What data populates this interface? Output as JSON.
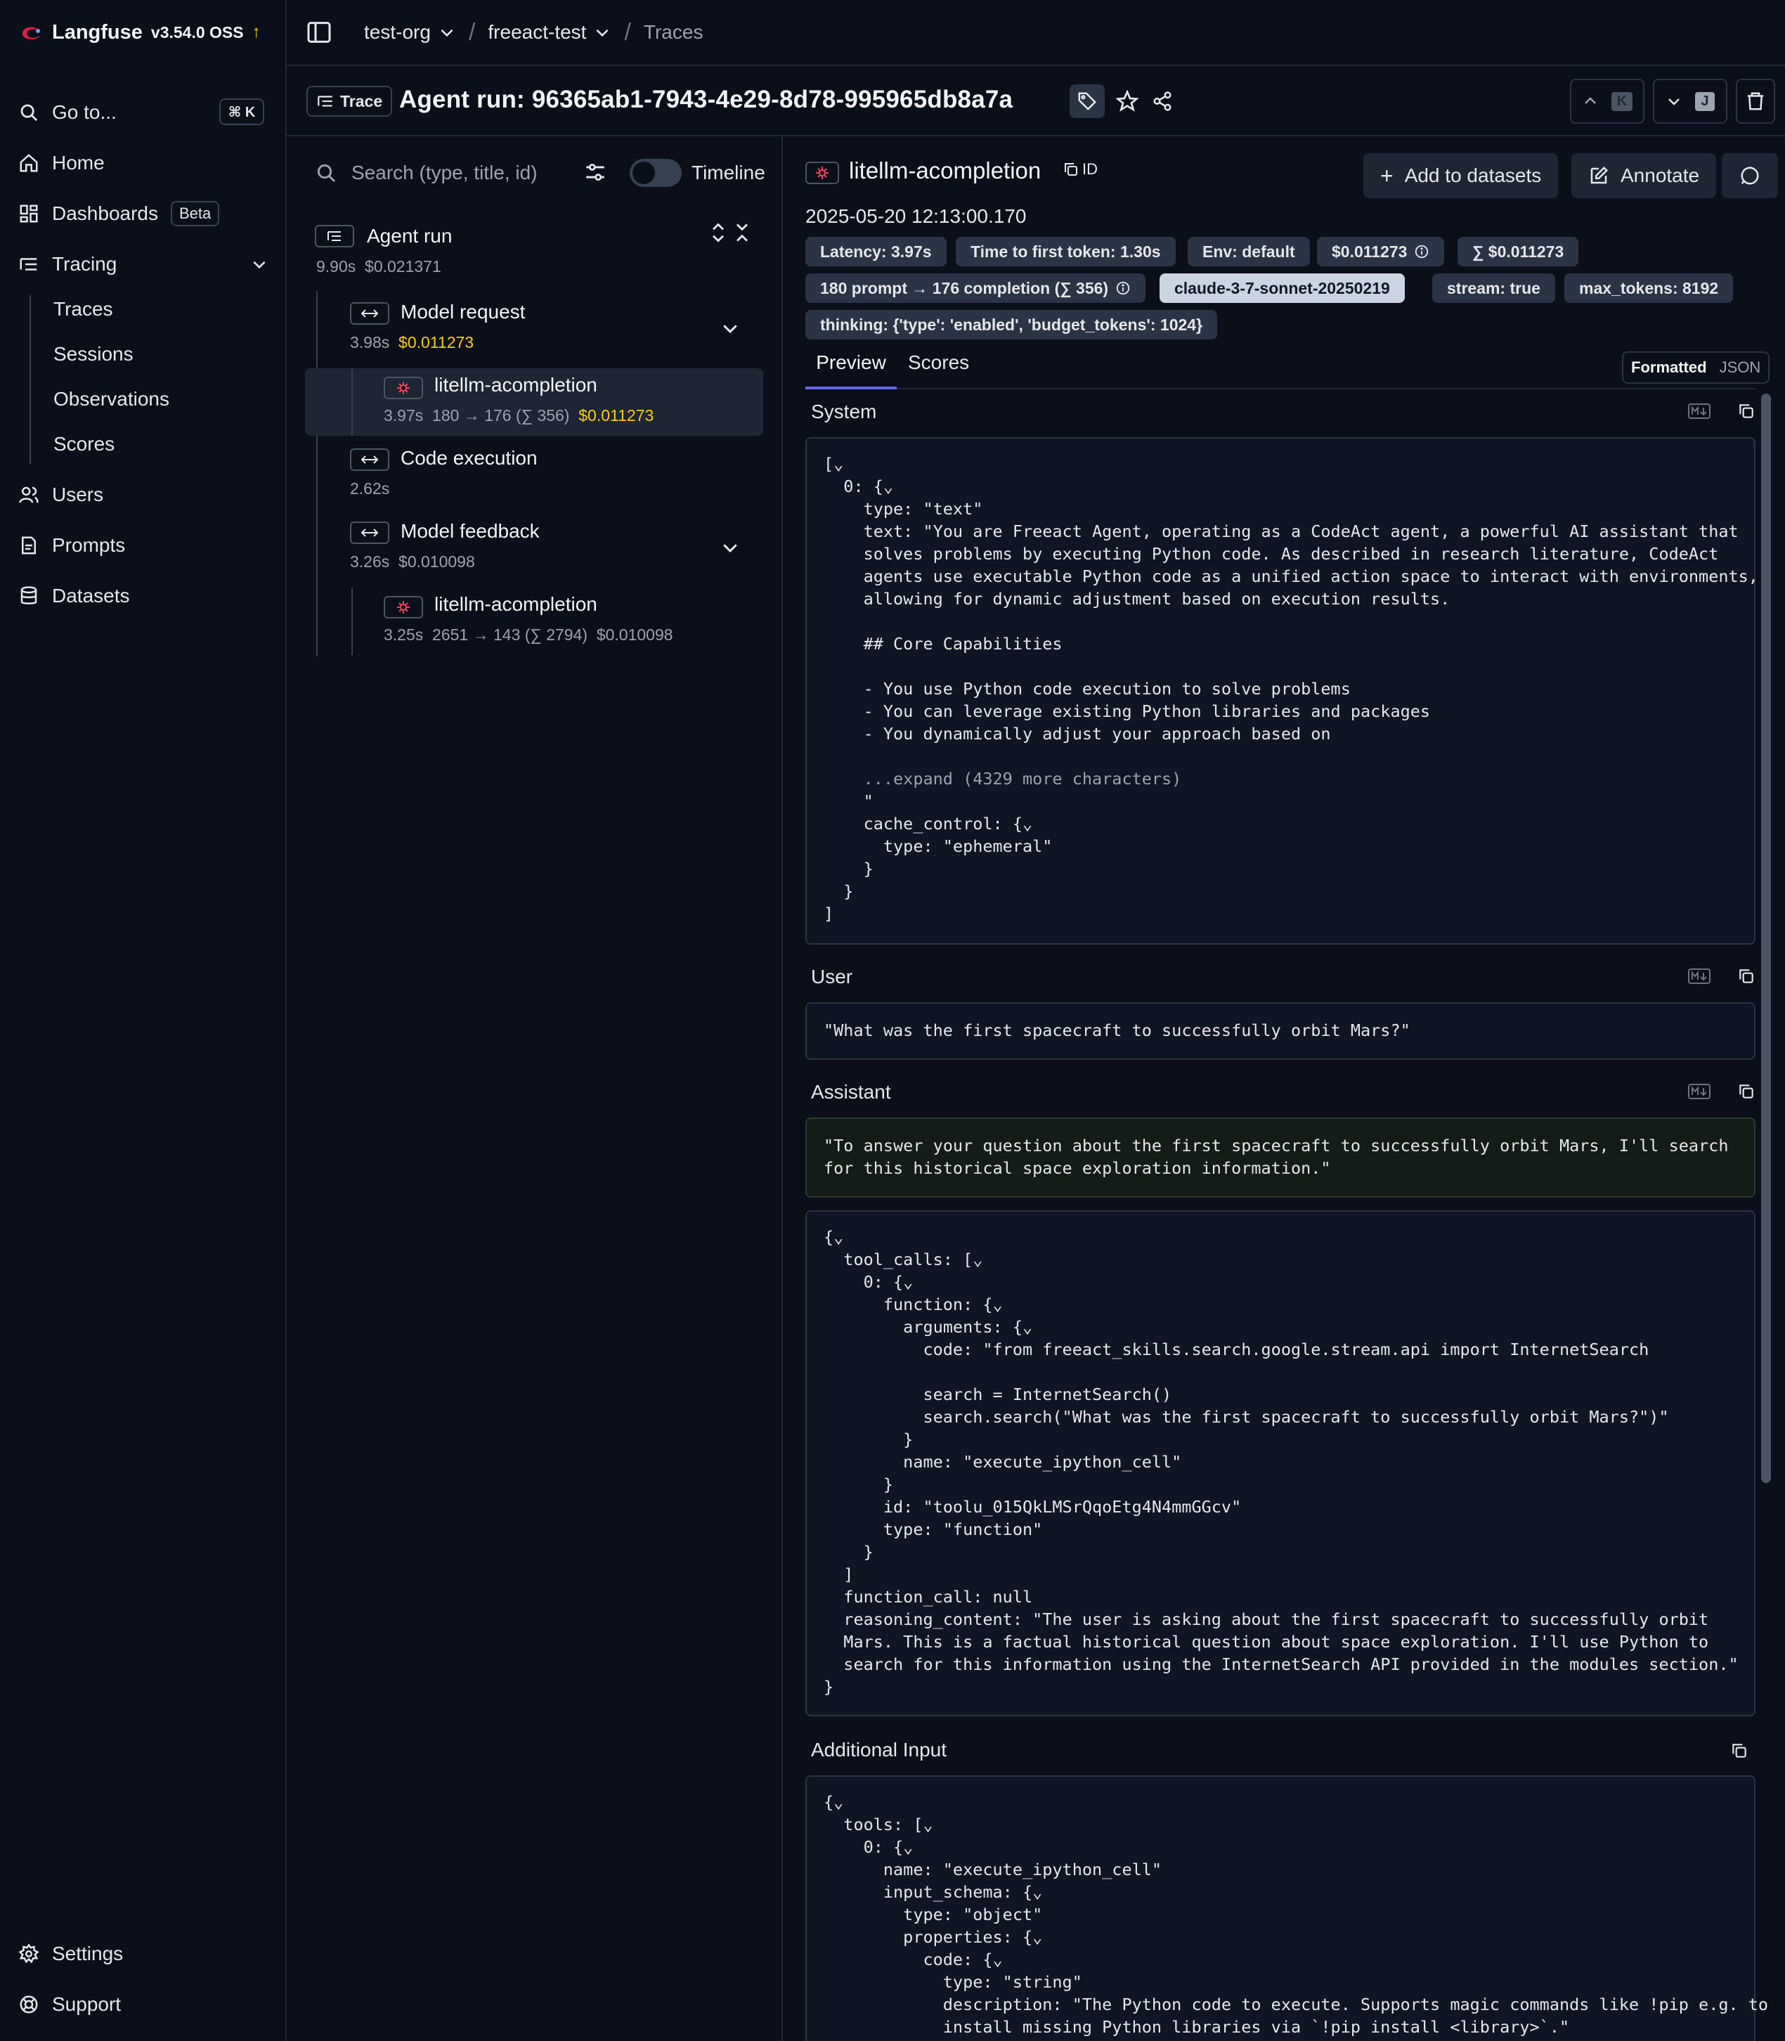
{
  "brand": {
    "name": "Langfuse",
    "version": "v3.54.0 OSS",
    "update_arrow": "↑"
  },
  "sidebar": {
    "goto": "Go to...",
    "goto_kbd": "⌘ K",
    "items": [
      {
        "label": "Home",
        "icon": "home-icon"
      },
      {
        "label": "Dashboards",
        "icon": "dashboard-icon",
        "badge": "Beta"
      },
      {
        "label": "Tracing",
        "icon": "tracing-icon"
      },
      {
        "label": "Users",
        "icon": "users-icon"
      },
      {
        "label": "Prompts",
        "icon": "prompts-icon"
      },
      {
        "label": "Datasets",
        "icon": "datasets-icon"
      }
    ],
    "tracing_sub": [
      "Traces",
      "Sessions",
      "Observations",
      "Scores"
    ],
    "settings": "Settings",
    "support": "Support"
  },
  "breadcrumb": {
    "org": "test-org",
    "project": "freeact-test",
    "page": "Traces"
  },
  "trace": {
    "badge": "Trace",
    "title": "Agent run: 96365ab1-7943-4e29-8d78-995965db8a7a",
    "nav_up_key": "K",
    "nav_down_key": "J"
  },
  "tree": {
    "search_placeholder": "Search (type, title, id)",
    "timeline_label": "Timeline",
    "root": {
      "title": "Agent run",
      "duration": "9.90s",
      "cost": "$0.021371"
    },
    "nodes": [
      {
        "title": "Model request",
        "duration": "3.98s",
        "cost": "$0.011273"
      },
      {
        "title": "litellm-acompletion",
        "duration": "3.97s",
        "tokens": "180 → 176 (∑ 356)",
        "cost": "$0.011273"
      },
      {
        "title": "Code execution",
        "duration": "2.62s"
      },
      {
        "title": "Model feedback",
        "duration": "3.26s",
        "cost": "$0.010098"
      },
      {
        "title": "litellm-acompletion",
        "duration": "3.25s",
        "tokens": "2651 → 143 (∑ 2794)",
        "cost": "$0.010098"
      }
    ]
  },
  "detail": {
    "title": "litellm-acompletion",
    "id_label": "ID",
    "timestamp": "2025-05-20 12:13:00.170",
    "add_to_datasets": "Add to datasets",
    "annotate": "Annotate",
    "pills": {
      "latency": "Latency: 3.97s",
      "ttft": "Time to first token: 1.30s",
      "env": "Env: default",
      "cost": "$0.011273",
      "total_cost": "∑ $0.011273",
      "tokens": "180 prompt → 176 completion (∑ 356)",
      "model": "claude-3-7-sonnet-20250219",
      "stream": "stream: true",
      "max_tokens": "max_tokens: 8192",
      "thinking": "thinking: {'type': 'enabled', 'budget_tokens': 1024}"
    },
    "tabs": [
      "Preview",
      "Scores"
    ],
    "view_toggle": [
      "Formatted",
      "JSON"
    ],
    "sections": {
      "system": "System",
      "user": "User",
      "assistant": "Assistant",
      "additional": "Additional Input"
    },
    "system_code": [
      "[⌄",
      "  0: {⌄",
      "    type: \"text\"",
      "    text: \"You are Freeact Agent, operating as a CodeAct agent, a powerful AI assistant that",
      "    solves problems by executing Python code. As described in research literature, CodeAct",
      "    agents use executable Python code as a unified action space to interact with environments,",
      "    allowing for dynamic adjustment based on execution results.",
      "",
      "    ## Core Capabilities",
      "",
      "    - You use Python code execution to solve problems",
      "    - You can leverage existing Python libraries and packages",
      "    - You dynamically adjust your approach based on",
      "",
      "    ...expand (4329 more characters)",
      "    \"",
      "    cache_control: {⌄",
      "      type: \"ephemeral\"",
      "    }",
      "  }",
      "]"
    ],
    "user_text": "\"What was the first spacecraft to successfully orbit Mars?\"",
    "assistant_text": [
      "\"To answer your question about the first spacecraft to successfully orbit Mars, I'll search",
      "for this historical space exploration information.\""
    ],
    "assistant_code": [
      "{⌄",
      "  tool_calls: [⌄",
      "    0: {⌄",
      "      function: {⌄",
      "        arguments: {⌄",
      "          code: \"from freeact_skills.search.google.stream.api import InternetSearch",
      "",
      "          search = InternetSearch()",
      "          search.search(\"What was the first spacecraft to successfully orbit Mars?\")\"",
      "        }",
      "        name: \"execute_ipython_cell\"",
      "      }",
      "      id: \"toolu_015QkLMSrQqoEtg4N4mmGGcv\"",
      "      type: \"function\"",
      "    }",
      "  ]",
      "  function_call: null",
      "  reasoning_content: \"The user is asking about the first spacecraft to successfully orbit",
      "  Mars. This is a factual historical question about space exploration. I'll use Python to",
      "  search for this information using the InternetSearch API provided in the modules section.\"",
      "}"
    ],
    "additional_code": [
      "{⌄",
      "  tools: [⌄",
      "    0: {⌄",
      "      name: \"execute_ipython_cell\"",
      "      input_schema: {⌄",
      "        type: \"object\"",
      "        properties: {⌄",
      "          code: {⌄",
      "            type: \"string\"",
      "            description: \"The Python code to execute. Supports magic commands like !pip e.g. to",
      "            install missing Python libraries via `!pip install <library>`.\""
    ]
  },
  "colors": {
    "accent_cost": "#facc15",
    "bg": "#0b0f19",
    "panel": "#0f1523",
    "pill": "#2b3445"
  }
}
